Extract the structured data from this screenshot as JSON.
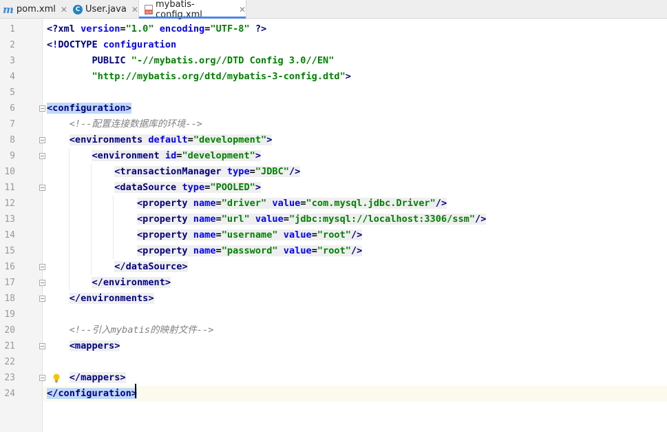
{
  "tabs": [
    {
      "label": "pom.xml",
      "icon": "maven-m-icon",
      "active": false
    },
    {
      "label": "User.java",
      "icon": "java-class-icon",
      "active": false
    },
    {
      "label": "mybatis-config.xml",
      "icon": "xml-file-icon",
      "active": true
    }
  ],
  "editor": {
    "current_line": 24,
    "line_numbers": [
      "1",
      "2",
      "3",
      "4",
      "5",
      "6",
      "7",
      "8",
      "9",
      "10",
      "11",
      "12",
      "13",
      "14",
      "15",
      "16",
      "17",
      "18",
      "19",
      "20",
      "21",
      "22",
      "23",
      "24"
    ],
    "lines": [
      [
        {
          "t": "<?",
          "c": "tag"
        },
        {
          "t": "xml ",
          "c": "tag"
        },
        {
          "t": "version",
          "c": "attr"
        },
        {
          "t": "=",
          "c": "plain"
        },
        {
          "t": "\"1.0\"",
          "c": "val"
        },
        {
          "t": " ",
          "c": "plain"
        },
        {
          "t": "encoding",
          "c": "attr"
        },
        {
          "t": "=",
          "c": "plain"
        },
        {
          "t": "\"UTF-8\"",
          "c": "val"
        },
        {
          "t": " ?>",
          "c": "tag"
        }
      ],
      [
        {
          "t": "<!DOCTYPE ",
          "c": "tag"
        },
        {
          "t": "configuration",
          "c": "attr"
        }
      ],
      [
        {
          "t": "        PUBLIC ",
          "c": "tag"
        },
        {
          "t": "\"-//mybatis.org//DTD Config 3.0//EN\"",
          "c": "val"
        }
      ],
      [
        {
          "t": "        ",
          "c": "plain"
        },
        {
          "t": "\"http://mybatis.org/dtd/mybatis-3-config.dtd\"",
          "c": "val"
        },
        {
          "t": ">",
          "c": "tag"
        }
      ],
      [],
      [
        {
          "t": "<configuration>",
          "c": "tag hl"
        }
      ],
      [
        {
          "t": "    ",
          "c": "plain"
        },
        {
          "t": "<!--配置连接数据库的环境-->",
          "c": "cmt"
        }
      ],
      [
        {
          "t": "    ",
          "c": "plain"
        },
        {
          "t": "<environments ",
          "c": "tag tagbg"
        },
        {
          "t": "default",
          "c": "attr tagbg"
        },
        {
          "t": "=",
          "c": "plain tagbg"
        },
        {
          "t": "\"development\"",
          "c": "val tagbg"
        },
        {
          "t": ">",
          "c": "tag tagbg"
        }
      ],
      [
        {
          "t": "        ",
          "c": "plain"
        },
        {
          "t": "<environment ",
          "c": "tag tagbg"
        },
        {
          "t": "id",
          "c": "attr tagbg"
        },
        {
          "t": "=",
          "c": "plain tagbg"
        },
        {
          "t": "\"development\"",
          "c": "val tagbg"
        },
        {
          "t": ">",
          "c": "tag tagbg"
        }
      ],
      [
        {
          "t": "            ",
          "c": "plain"
        },
        {
          "t": "<transactionManager ",
          "c": "tag tagbg"
        },
        {
          "t": "type",
          "c": "attr tagbg"
        },
        {
          "t": "=",
          "c": "plain tagbg"
        },
        {
          "t": "\"JDBC\"",
          "c": "val tagbg"
        },
        {
          "t": "/>",
          "c": "tag tagbg"
        }
      ],
      [
        {
          "t": "            ",
          "c": "plain"
        },
        {
          "t": "<dataSource ",
          "c": "tag tagbg"
        },
        {
          "t": "type",
          "c": "attr tagbg"
        },
        {
          "t": "=",
          "c": "plain tagbg"
        },
        {
          "t": "\"POOLED\"",
          "c": "val tagbg"
        },
        {
          "t": ">",
          "c": "tag tagbg"
        }
      ],
      [
        {
          "t": "                ",
          "c": "plain"
        },
        {
          "t": "<property ",
          "c": "tag tagbg"
        },
        {
          "t": "name",
          "c": "attr tagbg"
        },
        {
          "t": "=",
          "c": "plain tagbg"
        },
        {
          "t": "\"driver\"",
          "c": "val tagbg"
        },
        {
          "t": " ",
          "c": "plain tagbg"
        },
        {
          "t": "value",
          "c": "attr tagbg"
        },
        {
          "t": "=",
          "c": "plain tagbg"
        },
        {
          "t": "\"com.mysql.jdbc.Driver\"",
          "c": "val tagbg"
        },
        {
          "t": "/>",
          "c": "tag tagbg"
        }
      ],
      [
        {
          "t": "                ",
          "c": "plain"
        },
        {
          "t": "<property ",
          "c": "tag tagbg"
        },
        {
          "t": "name",
          "c": "attr tagbg"
        },
        {
          "t": "=",
          "c": "plain tagbg"
        },
        {
          "t": "\"url\"",
          "c": "val tagbg"
        },
        {
          "t": " ",
          "c": "plain tagbg"
        },
        {
          "t": "value",
          "c": "attr tagbg"
        },
        {
          "t": "=",
          "c": "plain tagbg"
        },
        {
          "t": "\"jdbc:mysql://localhost:3306/ssm\"",
          "c": "val tagbg"
        },
        {
          "t": "/>",
          "c": "tag tagbg"
        }
      ],
      [
        {
          "t": "                ",
          "c": "plain"
        },
        {
          "t": "<property ",
          "c": "tag tagbg"
        },
        {
          "t": "name",
          "c": "attr tagbg"
        },
        {
          "t": "=",
          "c": "plain tagbg"
        },
        {
          "t": "\"username\"",
          "c": "val tagbg"
        },
        {
          "t": " ",
          "c": "plain tagbg"
        },
        {
          "t": "value",
          "c": "attr tagbg"
        },
        {
          "t": "=",
          "c": "plain tagbg"
        },
        {
          "t": "\"root\"",
          "c": "val tagbg"
        },
        {
          "t": "/>",
          "c": "tag tagbg"
        }
      ],
      [
        {
          "t": "                ",
          "c": "plain"
        },
        {
          "t": "<property ",
          "c": "tag tagbg"
        },
        {
          "t": "name",
          "c": "attr tagbg"
        },
        {
          "t": "=",
          "c": "plain tagbg"
        },
        {
          "t": "\"password\"",
          "c": "val tagbg"
        },
        {
          "t": " ",
          "c": "plain tagbg"
        },
        {
          "t": "value",
          "c": "attr tagbg"
        },
        {
          "t": "=",
          "c": "plain tagbg"
        },
        {
          "t": "\"root\"",
          "c": "val tagbg"
        },
        {
          "t": "/>",
          "c": "tag tagbg"
        }
      ],
      [
        {
          "t": "            ",
          "c": "plain"
        },
        {
          "t": "</dataSource>",
          "c": "tag tagbg"
        }
      ],
      [
        {
          "t": "        ",
          "c": "plain"
        },
        {
          "t": "</environment>",
          "c": "tag tagbg"
        }
      ],
      [
        {
          "t": "    ",
          "c": "plain"
        },
        {
          "t": "</environments>",
          "c": "tag tagbg"
        }
      ],
      [],
      [
        {
          "t": "    ",
          "c": "plain"
        },
        {
          "t": "<!--引入mybatis的映射文件-->",
          "c": "cmt"
        }
      ],
      [
        {
          "t": "    ",
          "c": "plain"
        },
        {
          "t": "<mappers>",
          "c": "tag tagbg"
        }
      ],
      [],
      [
        {
          "t": "    ",
          "c": "plain"
        },
        {
          "t": "</mappers>",
          "c": "tag tagbg"
        }
      ],
      [
        {
          "t": "</configuration>",
          "c": "tag hl"
        }
      ]
    ]
  },
  "colors": {
    "tag": "#000080",
    "attribute": "#0000ff",
    "value": "#008000",
    "comment": "#808080",
    "match_highlight": "#bfd9f7",
    "current_line": "#fcfaed"
  }
}
